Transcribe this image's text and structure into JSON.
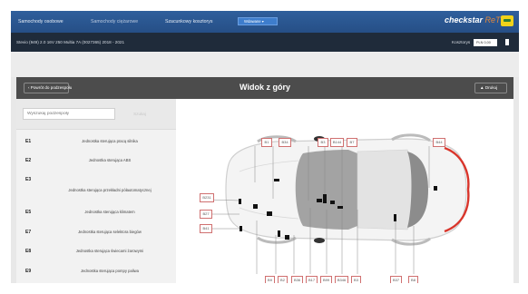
{
  "nav": {
    "tabs": [
      "Samochody osobowe",
      "Samochody ciężarowe",
      "Szacunkowy kosztorys"
    ],
    "dropdown": "Wdawane ▾",
    "logo_main": "checkstar",
    "logo_accent": "ReTIS"
  },
  "vehicle_bar": {
    "vehicle": "Stevio (949) 2.0 16V 250 Multia 7A (0027365) 2018 - 2021",
    "costs_label": "Kosztorys",
    "currency": "PLN  0,00"
  },
  "header": {
    "back_label": "‹  Powrót do podzespołu",
    "title": "Widok z góry",
    "print_label": "▲  Drukuj"
  },
  "search": {
    "placeholder": "Wyszukaj podzespoły",
    "button": "Szukaj"
  },
  "parts": [
    {
      "code": "E1",
      "name": "Jednostka sterująca pracą silnika"
    },
    {
      "code": "E2",
      "name": "Jednostka sterująca ABS"
    },
    {
      "code": "E3",
      "name": "Jednostka sterująca przekładni półautomatycznej"
    },
    {
      "code": "E5",
      "name": "Jednostka sterująca klimatem"
    },
    {
      "code": "E7",
      "name": "Jednostka sterująca selektora biegów"
    },
    {
      "code": "E8",
      "name": "Jednostka sterująca świecami żarowymi"
    },
    {
      "code": "E9",
      "name": "Jednostka sterująca pompy paliwa"
    }
  ],
  "diagram_labels": {
    "top": [
      "B1",
      "B34",
      "B3",
      "B144",
      "B7",
      "B44"
    ],
    "left": [
      "B231",
      "B27",
      "B41"
    ],
    "bottom": [
      "B9",
      "B2",
      "B36",
      "B17",
      "B99",
      "B346",
      "B3",
      "B37",
      "B8"
    ]
  },
  "colors": {
    "nav_bg": "#2b5994",
    "subbar_bg": "#1f2b3a",
    "header_bg": "#4c4c4c",
    "label_border": "#d07070",
    "accent_red": "#d9352b"
  }
}
